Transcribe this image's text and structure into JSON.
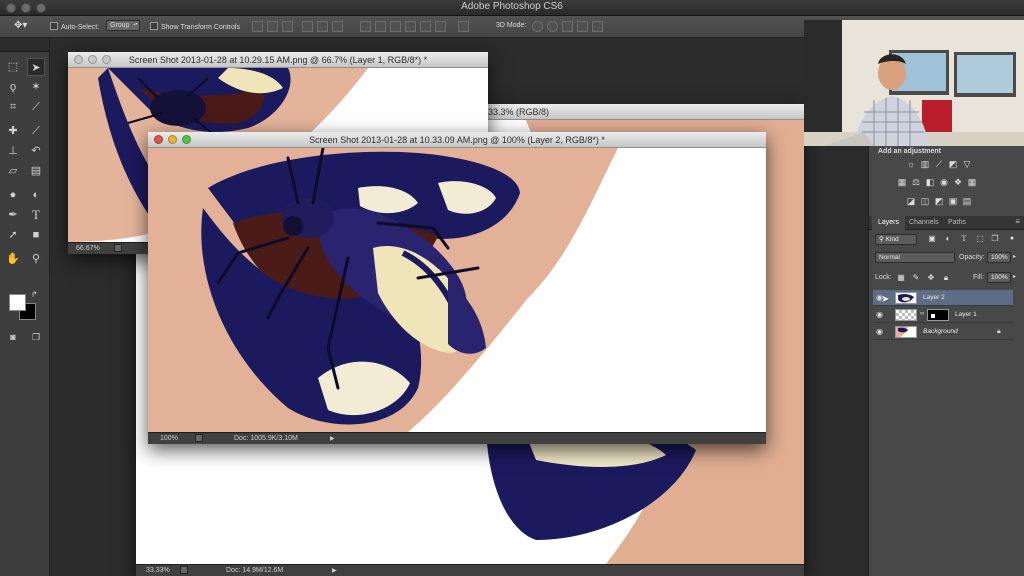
{
  "app": {
    "title": "Adobe Photoshop CS6"
  },
  "options_bar": {
    "auto_select_label": "Auto-Select:",
    "auto_select_value": "Group",
    "show_transform_label": "Show Transform Controls",
    "mode_3d_label": "3D Mode:"
  },
  "tools": [
    "move-tool",
    "marquee-tool",
    "lasso-tool",
    "magic-wand-tool",
    "crop-tool",
    "eyedropper-tool",
    "healing-brush-tool",
    "brush-tool",
    "clone-stamp-tool",
    "history-brush-tool",
    "eraser-tool",
    "gradient-tool",
    "blur-tool",
    "dodge-tool",
    "pen-tool",
    "type-tool",
    "path-selection-tool",
    "rectangle-tool",
    "hand-tool",
    "zoom-tool"
  ],
  "documents": [
    {
      "title": "Screen Shot 2013-01-28 at 10.29.15 AM.png @ 66.7% (Layer 1, RGB/8*) *",
      "zoom": "66.67%"
    },
    {
      "title": "33.3% (RGB/8)",
      "zoom": "33.33%",
      "doc": "Doc: 14.9M/12.6M"
    },
    {
      "title": "Screen Shot 2013-01-28 at 10.33.09 AM.png @ 100% (Layer 2, RGB/8*) *",
      "zoom": "100%",
      "doc": "Doc: 1005.9K/3.10M"
    }
  ],
  "adjustments": {
    "header": "Add an adjustment",
    "row1": [
      "brightness-icon",
      "levels-icon",
      "curves-icon",
      "exposure-icon",
      "vibrance-icon"
    ],
    "row2": [
      "hue-saturation-icon",
      "color-balance-icon",
      "black-white-icon",
      "photo-filter-icon",
      "channel-mixer-icon",
      "color-lookup-icon"
    ],
    "row3": [
      "invert-icon",
      "posterize-icon",
      "threshold-icon",
      "selective-color-icon",
      "gradient-map-icon"
    ]
  },
  "layers_panel": {
    "tabs": [
      "Layers",
      "Channels",
      "Paths"
    ],
    "kind_label": "Kind",
    "blend_mode": "Normal",
    "opacity_label": "Opacity:",
    "opacity_value": "100%",
    "lock_label": "Lock:",
    "fill_label": "Fill:",
    "fill_value": "100%",
    "layers": [
      {
        "name": "Layer 2",
        "selected": true
      },
      {
        "name": "Layer 1",
        "selected": false
      },
      {
        "name": "Background",
        "selected": false
      }
    ]
  },
  "colors": {
    "lip_blue": "#1c1a5e",
    "skin": "#e3b49a",
    "beetle_cream": "#efe5b8",
    "panel_bg": "#484848",
    "selection": "#5e6d86"
  }
}
